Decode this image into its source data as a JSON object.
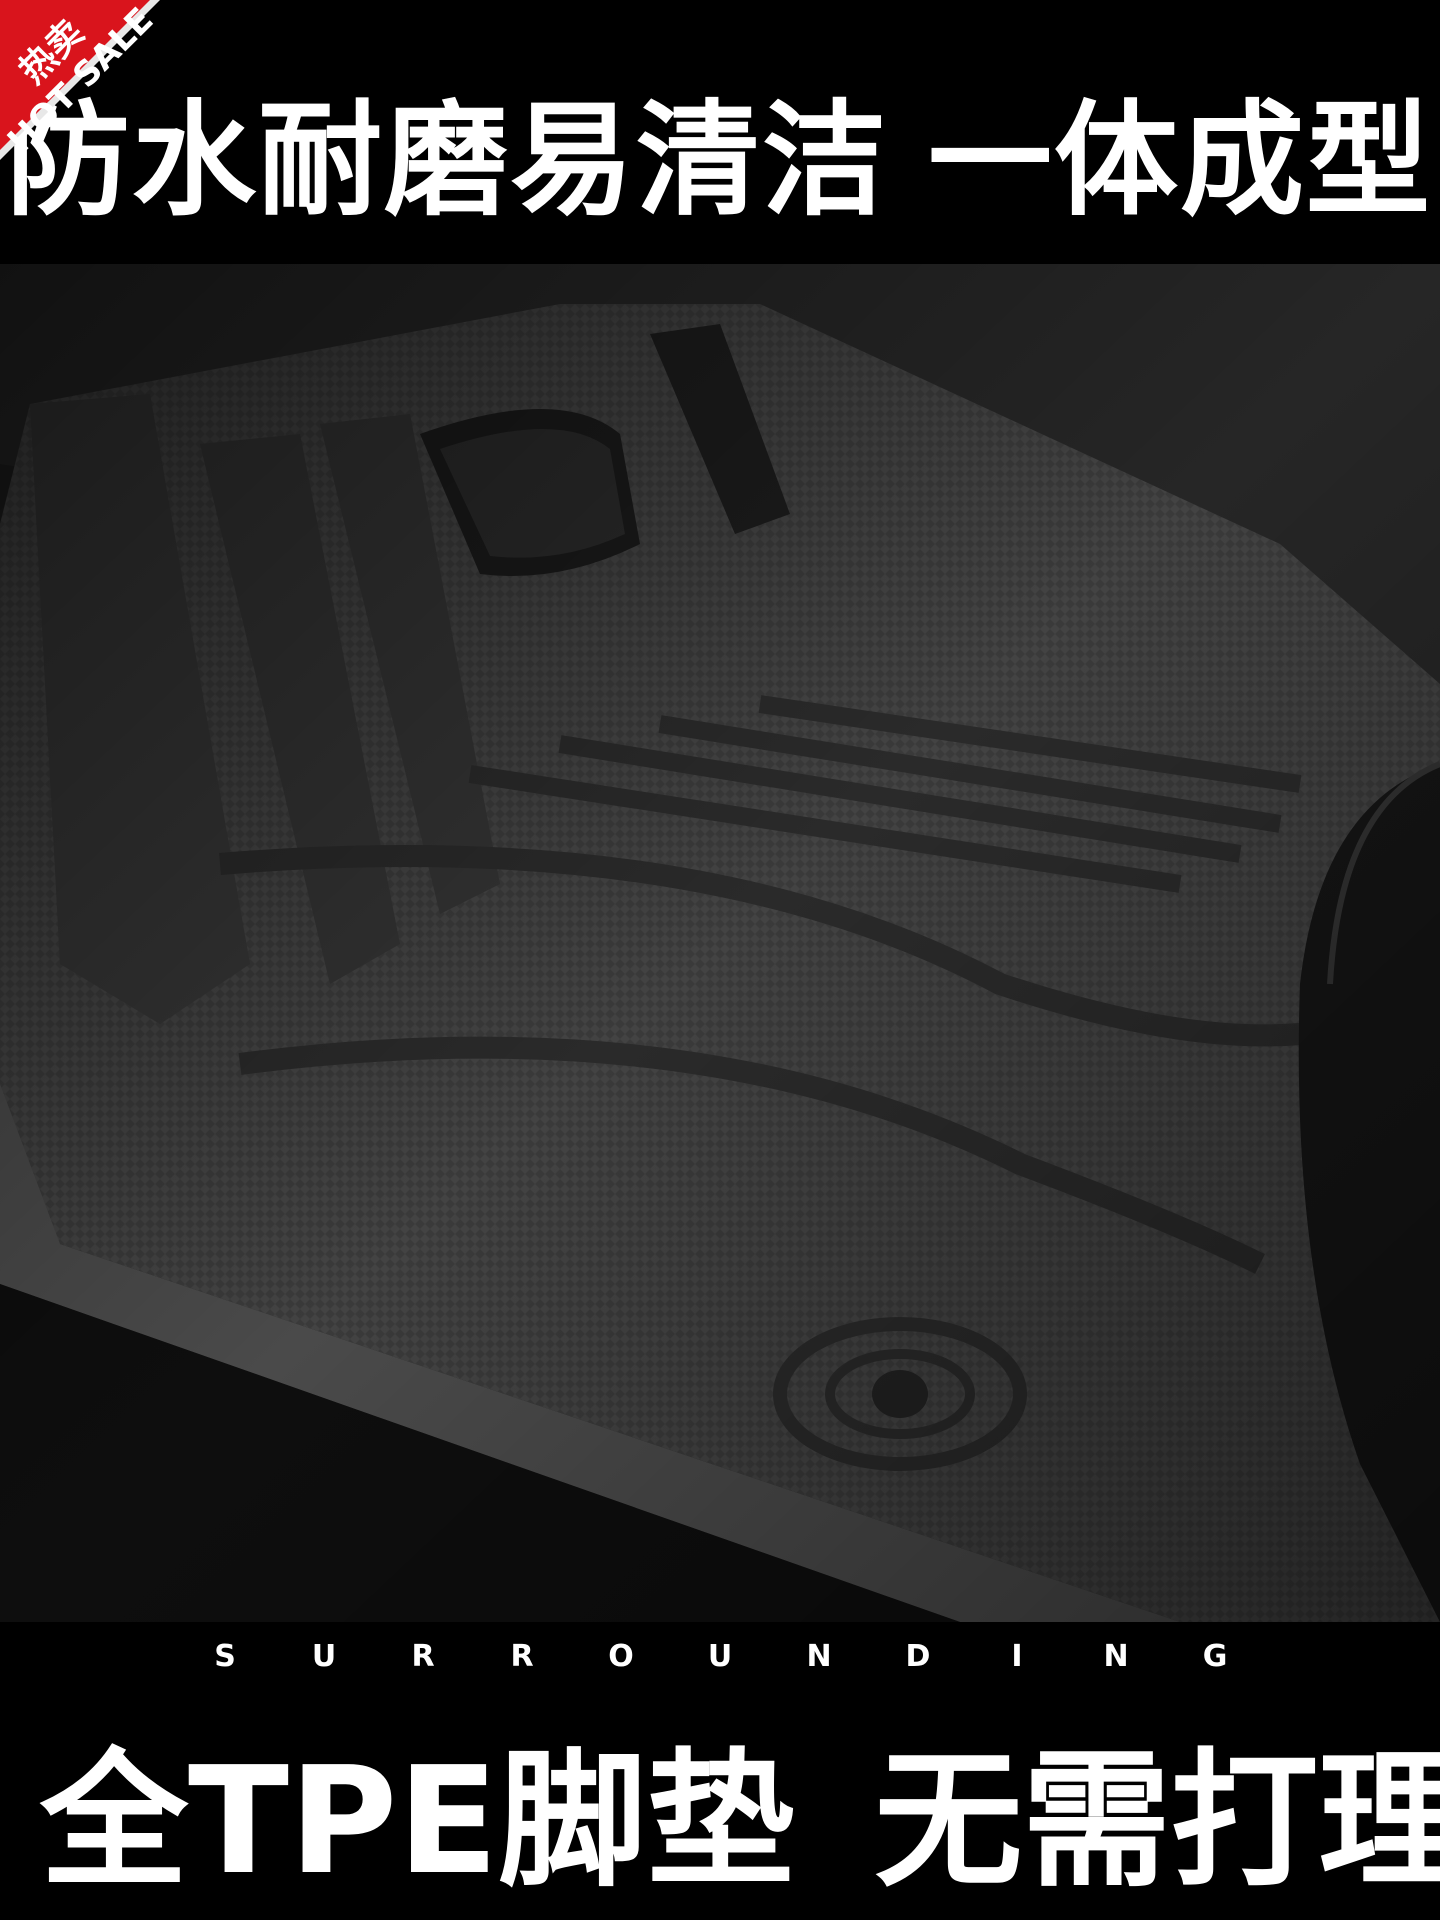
{
  "badge": {
    "line1": "热卖",
    "line2": "HOT SALE",
    "color": "#d9141c"
  },
  "headline": {
    "left": "防水耐磨易清洁",
    "right": "一体成型"
  },
  "surround": {
    "letters": [
      "S",
      "U",
      "R",
      "R",
      "O",
      "U",
      "N",
      "D",
      "I",
      "N",
      "G"
    ]
  },
  "bottom": {
    "left": "全TPE脚垫",
    "right": "无需打理"
  },
  "photo": {
    "subject": "car-floor-mat-icon"
  }
}
